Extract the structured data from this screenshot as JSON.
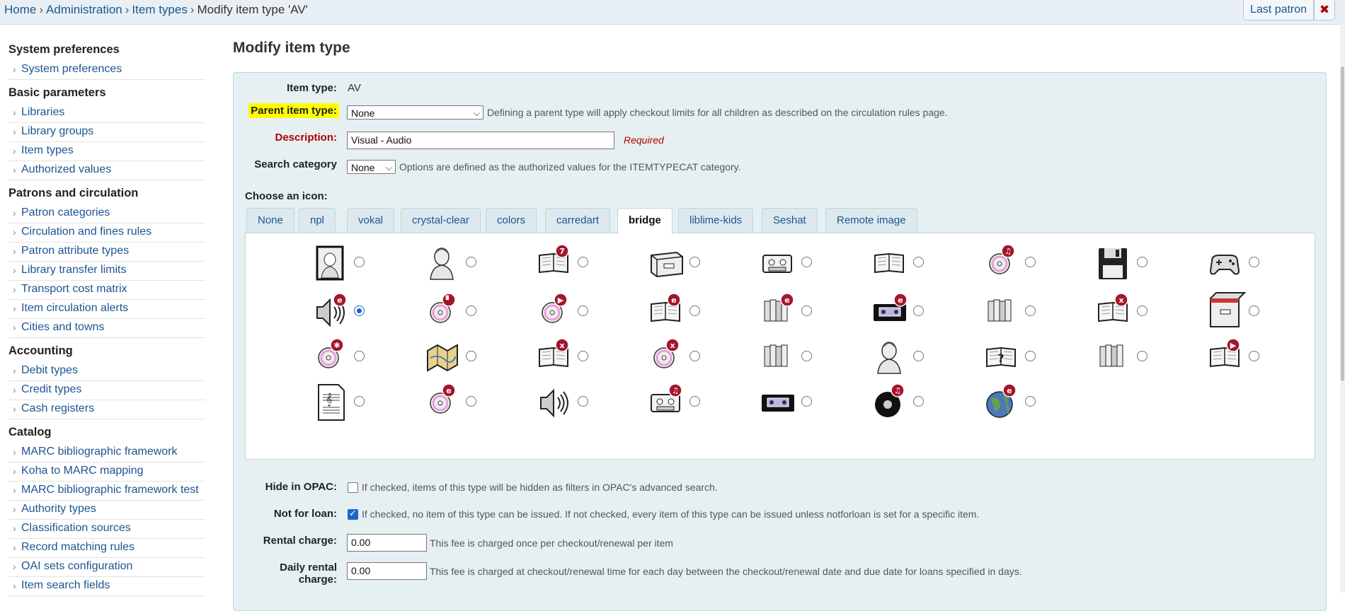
{
  "breadcrumb": {
    "home": "Home",
    "administration": "Administration",
    "item_types": "Item types",
    "current": "Modify item type 'AV'",
    "separator": "›"
  },
  "header": {
    "last_patron": "Last patron",
    "close_symbol": "✖"
  },
  "sidebar": {
    "sections": [
      {
        "title": "System preferences",
        "items": [
          "System preferences"
        ]
      },
      {
        "title": "Basic parameters",
        "items": [
          "Libraries",
          "Library groups",
          "Item types",
          "Authorized values"
        ]
      },
      {
        "title": "Patrons and circulation",
        "items": [
          "Patron categories",
          "Circulation and fines rules",
          "Patron attribute types",
          "Library transfer limits",
          "Transport cost matrix",
          "Item circulation alerts",
          "Cities and towns"
        ]
      },
      {
        "title": "Accounting",
        "items": [
          "Debit types",
          "Credit types",
          "Cash registers"
        ]
      },
      {
        "title": "Catalog",
        "items": [
          "MARC bibliographic framework",
          "Koha to MARC mapping",
          "MARC bibliographic framework test",
          "Authority types",
          "Classification sources",
          "Record matching rules",
          "OAI sets configuration",
          "Item search fields"
        ]
      }
    ]
  },
  "main": {
    "title": "Modify item type",
    "item_type_label": "Item type:",
    "item_type_value": "AV",
    "parent_label": "Parent item type:",
    "parent_value": "None",
    "parent_hint": "Defining a parent type will apply checkout limits for all children as described on the circulation rules page.",
    "description_label": "Description:",
    "description_value": "Visual - Audio",
    "description_required": "Required",
    "search_category_label": "Search category",
    "search_category_value": "None",
    "search_category_hint": "Options are defined as the authorized values for the ITEMTYPECAT category.",
    "choose_icon_label": "Choose an icon:",
    "icon_tabs": [
      "None",
      "npl",
      "vokal",
      "crystal-clear",
      "colors",
      "carredart",
      "bridge",
      "liblime-kids",
      "Seshat",
      "Remote image"
    ],
    "active_tab": "bridge",
    "icons": [
      [
        "portrait-icon",
        "bust-icon",
        "book-7-icon",
        "box-icon",
        "cassette-icon",
        "open-book-icon",
        "cd-music-icon",
        "floppy-disk-icon",
        "gamepad-icon"
      ],
      [
        "speaker-e-icon",
        "cd-film-icon",
        "cd-play-icon",
        "book-e-icon",
        "books-e-icon",
        "vhs-e-icon",
        "books-icon",
        "book-x-icon",
        "open-box-icon"
      ],
      [
        "cd-star-icon",
        "map-icon",
        "book-x-red-icon",
        "cd-x-icon",
        "books-stack-icon",
        "bust-2-icon",
        "book-question-icon",
        "books-shelf-icon",
        "book-flag-icon"
      ],
      [
        "sheet-music-icon",
        "cd-e-icon",
        "speaker-icon",
        "cassette-music-icon",
        "vhs-icon",
        "record-music-icon",
        "globe-e-icon"
      ]
    ],
    "selected_icon": "speaker-e-icon",
    "hide_opac_label": "Hide in OPAC:",
    "hide_opac_hint": "If checked, items of this type will be hidden as filters in OPAC's advanced search.",
    "hide_opac_checked": false,
    "not_for_loan_label": "Not for loan:",
    "not_for_loan_hint": "If checked, no item of this type can be issued. If not checked, every item of this type can be issued unless notforloan is set for a specific item.",
    "not_for_loan_checked": true,
    "rental_charge_label": "Rental charge:",
    "rental_charge_value": "0.00",
    "rental_charge_hint": "This fee is charged once per checkout/renewal per item",
    "daily_rental_label_1": "Daily rental",
    "daily_rental_label_2": "charge:",
    "daily_rental_value": "0.00",
    "daily_rental_hint": "This fee is charged at checkout/renewal time for each day between the checkout/renewal date and due date for loans specified in days."
  },
  "colors": {
    "link": "#1c5590",
    "required": "#b00000",
    "highlight": "#ffff00",
    "panel": "#e6f0f2",
    "badge": "#a5162b"
  }
}
